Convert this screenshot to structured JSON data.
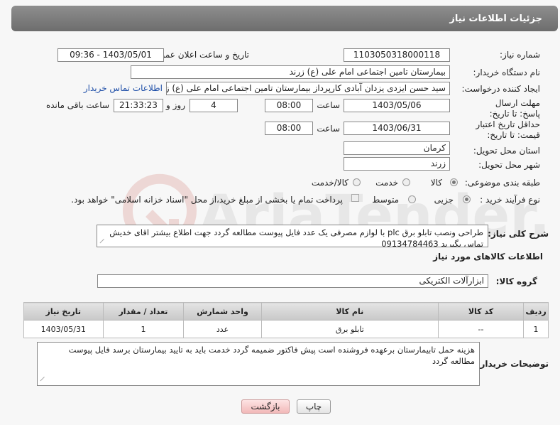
{
  "header": {
    "title": "جزئیات اطلاعات نیاز"
  },
  "fields": {
    "need_number": {
      "label": "شماره نیاز:",
      "value": "1103050318000118"
    },
    "announce_date": {
      "label": "تاریخ و ساعت اعلان عمومی:",
      "value": "1403/05/01 - 09:36"
    },
    "buyer_org": {
      "label": "نام دستگاه خریدار:",
      "value": "بیمارستان تامین اجتماعی امام علی (ع) زرند"
    },
    "requester": {
      "label": "ایجاد کننده درخواست:",
      "value": "سید حسن ایزدی یزدان آبادی کارپرداز بیمارستان تامین اجتماعی امام علی (ع) زرند",
      "contact_link": "اطلاعات تماس خریدار"
    },
    "reply_deadline": {
      "label": "مهلت ارسال پاسخ: تا تاریخ:",
      "date": "1403/05/06",
      "time_label": "ساعت",
      "time": "08:00",
      "days": "4",
      "days_label": "روز و",
      "remaining": "21:33:23",
      "remaining_label": "ساعت باقی مانده"
    },
    "price_validity": {
      "label": "حداقل تاریخ اعتبار قیمت: تا تاریخ:",
      "date": "1403/06/31",
      "time_label": "ساعت",
      "time": "08:00"
    },
    "province": {
      "label": "استان محل تحویل:",
      "value": "کرمان"
    },
    "city": {
      "label": "شهر محل تحویل:",
      "value": "زرند"
    },
    "category": {
      "label": "طبقه بندی موضوعی:",
      "options": [
        "کالا",
        "خدمت",
        "کالا/خدمت"
      ],
      "selected": "کالا"
    },
    "purchase_type": {
      "label": "نوع فرآیند خرید :",
      "options": [
        "جزیی",
        "متوسط"
      ],
      "selected": "جزیی",
      "note": "پرداخت تمام یا بخشی از مبلغ خرید،از محل \"اسناد خزانه اسلامی\" خواهد بود."
    }
  },
  "description": {
    "label": "شرح کلی نیاز:",
    "value": "طراحی ونصب تابلو برق plc با لوازم مصرفی یک عدد  فایل پیوست مطالعه گردد جهت اطلاع بیشتر اقای خدیش تماس بگیرید 09134784463"
  },
  "goods_info": {
    "title": "اطلاعات کالاهای مورد نیاز",
    "group_label": "گروه کالا:",
    "group_value": "ابزارآلات الکتریکی"
  },
  "table": {
    "headers": [
      "ردیف",
      "کد کالا",
      "نام کالا",
      "واحد شمارش",
      "تعداد / مقدار",
      "تاریخ نیاز"
    ],
    "rows": [
      [
        "1",
        "--",
        "تابلو برق",
        "عدد",
        "1",
        "1403/05/31"
      ]
    ]
  },
  "buyer_notes": {
    "label": "توضیحات خریدار:",
    "value": "هزینه حمل تابیمارستان برعهده فروشنده است پیش فاکتور ضمیمه گردد خدمت باید به تایید بیمارستان برسد فایل پیوست مطالعه گردد"
  },
  "buttons": {
    "print": "چاپ",
    "back": "بازگشت"
  },
  "watermark": {
    "text": "AriaTender.neT"
  },
  "colors": {
    "header_bg": "#7a7a7a",
    "link": "#1f4fa8",
    "back_button": "#f2b9b9"
  }
}
